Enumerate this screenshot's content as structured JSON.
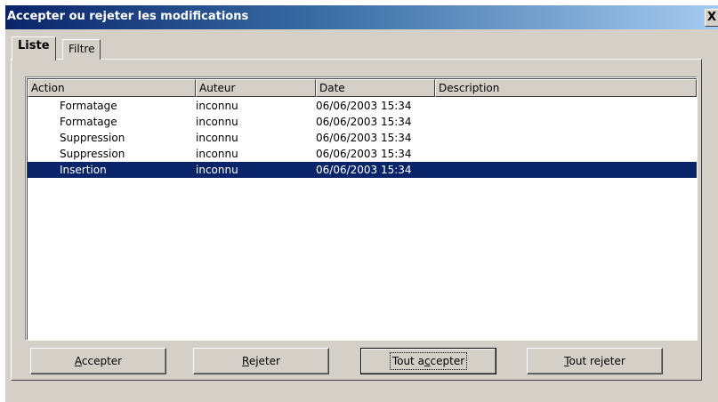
{
  "window": {
    "title": "Accepter ou rejeter les modifications",
    "close_glyph": "X"
  },
  "tabs": [
    {
      "label": "Liste",
      "active": true
    },
    {
      "label": "Filtre",
      "active": false
    }
  ],
  "table": {
    "columns": [
      "Action",
      "Auteur",
      "Date",
      "Description"
    ],
    "rows": [
      {
        "action": "Formatage",
        "auteur": "inconnu",
        "date": "06/06/2003 15:34",
        "description": ""
      },
      {
        "action": "Formatage",
        "auteur": "inconnu",
        "date": "06/06/2003 15:34",
        "description": ""
      },
      {
        "action": "Suppression",
        "auteur": "inconnu",
        "date": "06/06/2003 15:34",
        "description": ""
      },
      {
        "action": "Suppression",
        "auteur": "inconnu",
        "date": "06/06/2003 15:34",
        "description": ""
      },
      {
        "action": "Insertion",
        "auteur": "inconnu",
        "date": "06/06/2003 15:34",
        "description": "",
        "selected": true
      }
    ]
  },
  "buttons": {
    "accepter": {
      "pre": "",
      "key": "A",
      "post": "ccepter"
    },
    "rejeter": {
      "pre": "",
      "key": "R",
      "post": "ejeter"
    },
    "tout_accepter": {
      "pre": "Tout a",
      "key": "c",
      "post": "cepter"
    },
    "tout_rejeter": {
      "pre": "",
      "key": "T",
      "post": "out rejeter"
    }
  },
  "colors": {
    "dialog_bg": "#d4d0c8",
    "title_start": "#0a246a",
    "selection": "#0a246a"
  }
}
